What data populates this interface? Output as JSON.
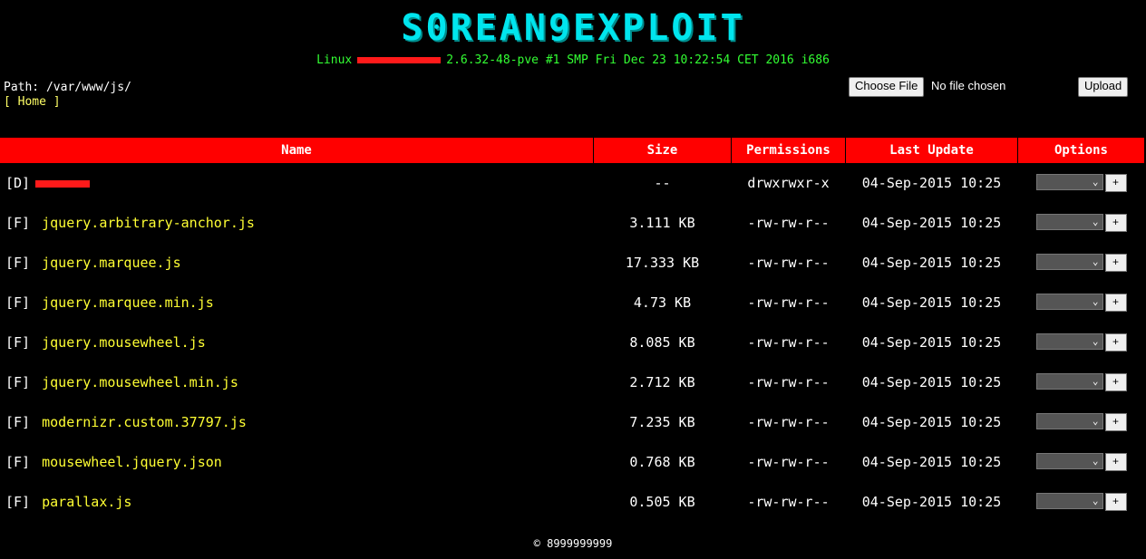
{
  "header": {
    "title": "S0REAN9EXPLOIT",
    "uname_prefix": "Linux",
    "uname_suffix": "2.6.32-48-pve #1 SMP Fri Dec 23 10:22:54 CET 2016 i686"
  },
  "nav": {
    "path_label": "Path: ",
    "path_sep1": "/",
    "path_seg1": "var",
    "path_sep2": "/",
    "path_seg2": "www",
    "path_sep3": "/",
    "path_seg3": "js",
    "path_sep4": "/",
    "home_open": "[ ",
    "home_label": "Home",
    "home_close": " ]"
  },
  "upload": {
    "choose_label": "Choose File",
    "no_file_text": "No file chosen",
    "upload_label": "Upload"
  },
  "table": {
    "headers": {
      "name": "Name",
      "size": "Size",
      "permissions": "Permissions",
      "last_update": "Last Update",
      "options": "Options"
    },
    "rows": [
      {
        "type": "[D]",
        "name": "",
        "size": "--",
        "perm": "drwxrwxr-x",
        "date": "04-Sep-2015 10:25",
        "plus": "+"
      },
      {
        "type": "[F]",
        "name": "jquery.arbitrary-anchor.js",
        "size": "3.111 KB",
        "perm": "-rw-rw-r--",
        "date": "04-Sep-2015 10:25",
        "plus": "+"
      },
      {
        "type": "[F]",
        "name": "jquery.marquee.js",
        "size": "17.333 KB",
        "perm": "-rw-rw-r--",
        "date": "04-Sep-2015 10:25",
        "plus": "+"
      },
      {
        "type": "[F]",
        "name": "jquery.marquee.min.js",
        "size": "4.73 KB",
        "perm": "-rw-rw-r--",
        "date": "04-Sep-2015 10:25",
        "plus": "+"
      },
      {
        "type": "[F]",
        "name": "jquery.mousewheel.js",
        "size": "8.085 KB",
        "perm": "-rw-rw-r--",
        "date": "04-Sep-2015 10:25",
        "plus": "+"
      },
      {
        "type": "[F]",
        "name": "jquery.mousewheel.min.js",
        "size": "2.712 KB",
        "perm": "-rw-rw-r--",
        "date": "04-Sep-2015 10:25",
        "plus": "+"
      },
      {
        "type": "[F]",
        "name": "modernizr.custom.37797.js",
        "size": "7.235 KB",
        "perm": "-rw-rw-r--",
        "date": "04-Sep-2015 10:25",
        "plus": "+"
      },
      {
        "type": "[F]",
        "name": "mousewheel.jquery.json",
        "size": "0.768 KB",
        "perm": "-rw-rw-r--",
        "date": "04-Sep-2015 10:25",
        "plus": "+"
      },
      {
        "type": "[F]",
        "name": "parallax.js",
        "size": "0.505 KB",
        "perm": "-rw-rw-r--",
        "date": "04-Sep-2015 10:25",
        "plus": "+"
      }
    ]
  },
  "footer": {
    "text": "© 8999999999"
  },
  "colors": {
    "background": "#000000",
    "title": "#00e5ee",
    "uname": "#33ff33",
    "header_red": "#ff0000",
    "link_yellow": "#ffff33"
  }
}
